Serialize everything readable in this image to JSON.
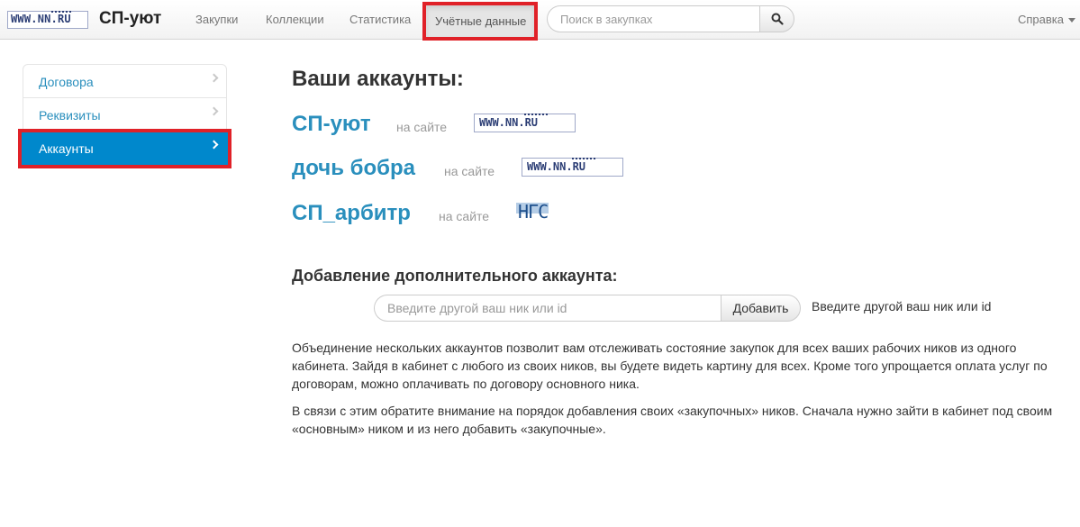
{
  "navbar": {
    "logo_text": "WWW.NN.RU",
    "brand": "СП-уют",
    "links": [
      "Закупки",
      "Коллекции",
      "Статистика"
    ],
    "active_link": "Учётные данные",
    "search_placeholder": "Поиск в закупках",
    "help": "Справка"
  },
  "sidebar": {
    "items": [
      {
        "label": "Договора",
        "active": false
      },
      {
        "label": "Реквизиты",
        "active": false
      },
      {
        "label": "Аккаунты",
        "active": true
      }
    ]
  },
  "main": {
    "title": "Ваши аккаунты:",
    "accounts": [
      {
        "name": "СП-уют",
        "site_label": "на сайте",
        "site_logo": "WWW.NN.RU"
      },
      {
        "name": "дочь бобра",
        "site_label": "на сайте",
        "site_logo": "WWW.NN.RU"
      },
      {
        "name": "СП_арбитр",
        "site_label": "на сайте",
        "site_logo": "НГС"
      }
    ],
    "add_title": "Добавление дополнительного аккаунта:",
    "add_placeholder": "Введите другой ваш ник или id",
    "add_button": "Добавить",
    "add_help": "Введите другой ваш ник или id",
    "paragraph1": "Объединение нескольких аккаунтов позволит вам отслеживать состояние закупок для всех ваших рабочих ников из одного кабинета. Зайдя в кабинет с любого из своих ников, вы будете видеть картину для всех. Кроме того упрощается оплата услуг по договорам, можно оплачивать по договору основного ника.",
    "paragraph2": "В связи с этим обратите внимание на порядок добавления своих «закупочных» ников. Сначала нужно зайти в кабинет под своим «основным» ником и из него добавить «закупочные»."
  },
  "colors": {
    "accent": "#0088cc",
    "link": "#2a8fbd",
    "highlight": "#e02128"
  }
}
